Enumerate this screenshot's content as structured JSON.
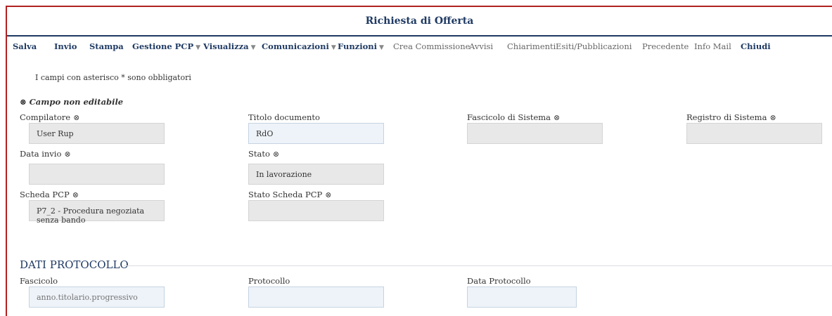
{
  "title": "Richiesta di Offerta",
  "toolbar": {
    "salva": "Salva",
    "invio": "Invio",
    "stampa": "Stampa",
    "gestione_pcp": "Gestione PCP",
    "visualizza": "Visualizza",
    "comunicazioni": "Comunicazioni",
    "funzioni": "Funzioni",
    "crea_commissione": "Crea Commissione",
    "avvisi": "Avvisi",
    "chiarimenti": "Chiarimenti",
    "esiti": "Esiti/Pubblicazioni",
    "precedente": "Precedente",
    "info_mail": "Info Mail",
    "chiudi": "Chiudi",
    "caret": "▼"
  },
  "note": "I campi con asterisco * sono obbligatori",
  "non_editable": "Campo non editabile",
  "lock_glyph": "⊗",
  "fields": {
    "compilatore": {
      "label": "Compilatore",
      "value": "User Rup"
    },
    "titolo_documento": {
      "label": "Titolo documento",
      "value": "RdO"
    },
    "fascicolo_sistema": {
      "label": "Fascicolo di Sistema",
      "value": ""
    },
    "registro_sistema": {
      "label": "Registro di Sistema",
      "value": ""
    },
    "data_invio": {
      "label": "Data invio",
      "value": ""
    },
    "stato": {
      "label": "Stato",
      "value": "In lavorazione"
    },
    "scheda_pcp": {
      "label": "Scheda PCP",
      "value": "P7_2 - Procedura negoziata senza bando"
    },
    "stato_scheda_pcp": {
      "label": "Stato Scheda PCP",
      "value": ""
    }
  },
  "protocollo": {
    "heading": "DATI PROTOCOLLO",
    "fascicolo": {
      "label": "Fascicolo",
      "placeholder": "anno.titolario.progressivo"
    },
    "protocollo": {
      "label": "Protocollo",
      "value": ""
    },
    "data_protocollo": {
      "label": "Data Protocollo",
      "value": ""
    }
  }
}
